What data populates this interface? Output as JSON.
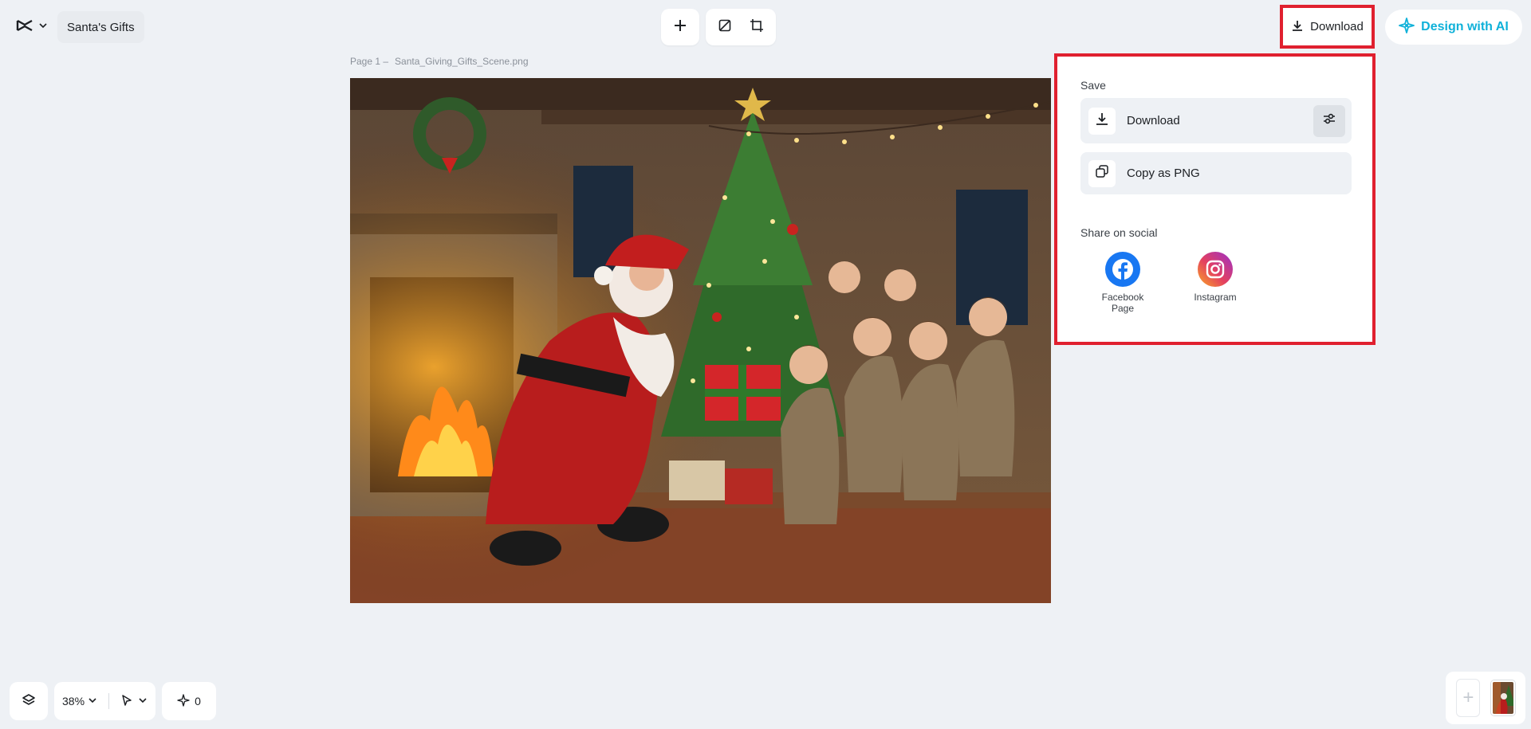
{
  "header": {
    "project_title": "Santa's Gifts",
    "download_label": "Download",
    "design_ai_label": "Design with AI"
  },
  "canvas": {
    "page_label": "Page 1 –",
    "file_name": "Santa_Giving_Gifts_Scene.png"
  },
  "download_panel": {
    "save_title": "Save",
    "download_label": "Download",
    "copy_png_label": "Copy as PNG",
    "share_title": "Share on social",
    "social": [
      {
        "label_line1": "Facebook",
        "label_line2": "Page"
      },
      {
        "label_line1": "Instagram",
        "label_line2": ""
      }
    ]
  },
  "footer": {
    "zoom": "38%",
    "ai_count": "0"
  },
  "colors": {
    "accent_red": "#e0202f",
    "ai_cyan": "#0fb1d9",
    "facebook": "#1877f2"
  },
  "icons": [
    "capcut-logo-icon",
    "chevron-down-icon",
    "plus-icon",
    "resize-icon",
    "crop-icon",
    "download-icon",
    "design-ai-icon",
    "settings-sliders-icon",
    "copy-icon",
    "facebook-icon",
    "instagram-icon",
    "layers-icon",
    "pointer-icon",
    "sparkle-icon"
  ]
}
